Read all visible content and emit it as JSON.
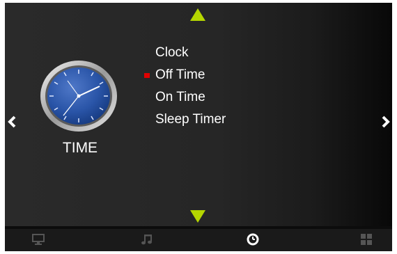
{
  "menu": {
    "category_label": "TIME",
    "category_icon": "analog-clock-icon",
    "items": [
      {
        "label": "Clock",
        "selected": false
      },
      {
        "label": "Off Time",
        "selected": true
      },
      {
        "label": "On Time",
        "selected": false
      },
      {
        "label": "Sleep Timer",
        "selected": false
      }
    ]
  },
  "bottom_tabs": [
    {
      "icon": "monitor-icon",
      "active": false
    },
    {
      "icon": "music-note-icon",
      "active": false
    },
    {
      "icon": "clock-icon",
      "active": true
    },
    {
      "icon": "grid-icon",
      "active": false
    }
  ],
  "colors": {
    "arrow_accent": "#b5d600",
    "selection_marker": "#e00000",
    "text": "#ffffff",
    "inactive_icon": "#555555",
    "active_icon": "#ffffff"
  }
}
